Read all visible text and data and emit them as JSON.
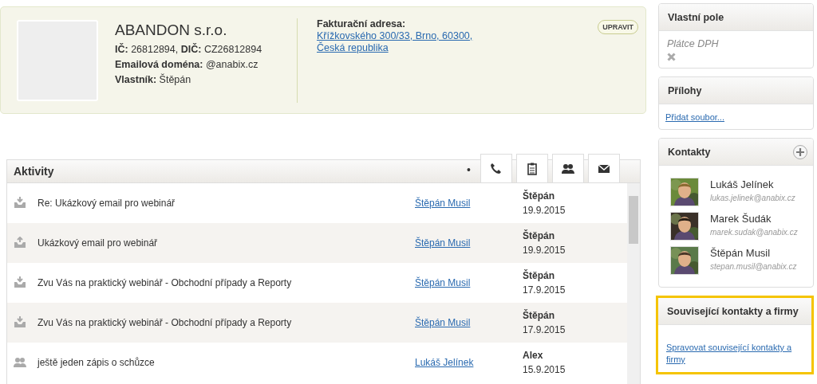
{
  "company": {
    "name": "ABANDON s.r.o.",
    "details": [
      {
        "label": "IČ:",
        "value": "26812894,",
        "label2": "DIČ:",
        "value2": "CZ26812894"
      },
      {
        "label": "Emailová doména:",
        "value": "@anabix.cz"
      },
      {
        "label": "Vlastník:",
        "value": "Štěpán"
      }
    ],
    "billing_label": "Fakturační adresa:",
    "billing_lines": [
      "Křížkovského 300/33, Brno, 60300,",
      "Česká republika"
    ],
    "edit_button": "UPRAVIT"
  },
  "activities": {
    "title": "Aktivity",
    "dot": "•",
    "tabs": [
      {
        "kind": "phone"
      },
      {
        "kind": "note"
      },
      {
        "kind": "meeting"
      },
      {
        "kind": "email"
      }
    ],
    "rows": [
      {
        "kind": "email-in",
        "subject": "Re: Ukázkový email pro webinář",
        "contact": "Štěpán Musil",
        "author": "Štěpán",
        "date": "19.9.2015"
      },
      {
        "kind": "email-out",
        "subject": "Ukázkový email pro webinář",
        "contact": "Štěpán Musil",
        "author": "Štěpán",
        "date": "19.9.2015"
      },
      {
        "kind": "email-in",
        "subject": "Zvu Vás na praktický webinář - Obchodní případy a Reporty",
        "contact": "Štěpán Musil",
        "author": "Štěpán",
        "date": "17.9.2015"
      },
      {
        "kind": "email-in",
        "subject": "Zvu Vás na praktický webinář - Obchodní případy a Reporty",
        "contact": "Štěpán Musil",
        "author": "Štěpán",
        "date": "17.9.2015"
      },
      {
        "kind": "meeting",
        "subject": "ještě jeden zápis o schůzce",
        "contact": "Lukáš Jelínek",
        "author": "Alex",
        "date": "15.9.2015"
      }
    ]
  },
  "custom_fields": {
    "title": "Vlastní pole",
    "fields": [
      {
        "label": "Plátce DPH",
        "checked": false
      }
    ]
  },
  "attachments": {
    "title": "Přílohy",
    "link": "Přidat soubor..."
  },
  "contacts": {
    "title": "Kontakty",
    "items": [
      {
        "name": "Lukáš Jelínek",
        "email": "lukas.jelinek@anabix.cz"
      },
      {
        "name": "Marek Šudák",
        "email": "marek.sudak@anabix.cz"
      },
      {
        "name": "Štěpán Musil",
        "email": "stepan.musil@anabix.cz"
      }
    ]
  },
  "related": {
    "title": "Související kontakty a firmy",
    "link": "Spravovat související kontakty a firmy",
    "highlighted": true
  }
}
